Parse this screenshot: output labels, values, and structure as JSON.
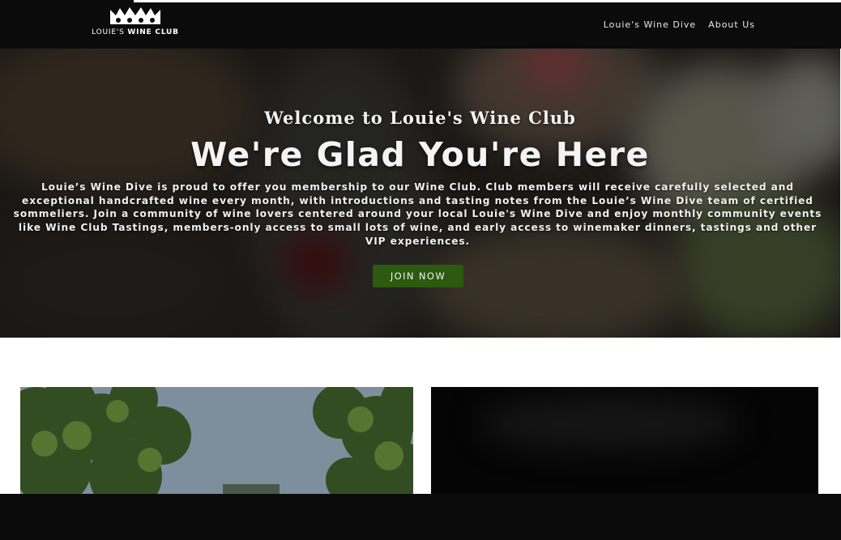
{
  "brand": {
    "logo_icon": "crown-icon",
    "name_prefix": "LOUIE'S",
    "name_suffix": "WINE CLUB"
  },
  "nav": {
    "items": [
      {
        "label": "Louie's Wine Dive"
      },
      {
        "label": "About Us"
      }
    ]
  },
  "hero": {
    "kicker": "Welcome to Louie's Wine Club",
    "title": "We're Glad You're Here",
    "body": "Louie’s Wine Dive is proud to offer you membership to our Wine Club. Club members will receive carefully selected and exceptional handcrafted wine every month, with introductions and tasting notes from the Louie’s Wine Dive team of certified sommeliers. Join a community of wine lovers centered around your local Louie's Wine Dive and enjoy monthly community events like Wine Club Tastings, members-only access to small lots of wine, and early access to winemaker dinners, tastings and other VIP experiences.",
    "cta_label": "JOIN NOW",
    "background_image": "wine-glass-table-photo"
  },
  "cards": {
    "left_image": "trees-sky-photo",
    "right_image": "dark-photo"
  },
  "colors": {
    "header_bg": "#0b0b0b",
    "cta_bg": "#2c5a0e",
    "text_light": "#f2f2f2"
  }
}
